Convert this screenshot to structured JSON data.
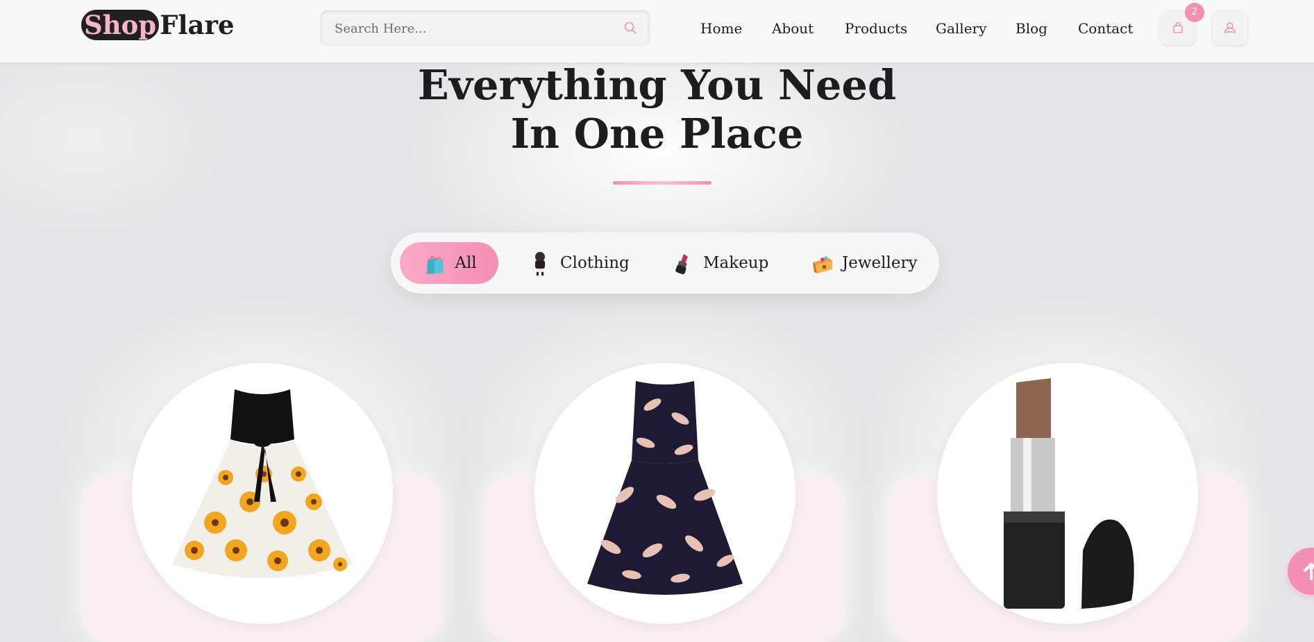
{
  "brand": {
    "part1": "Shop",
    "part2": "Flare"
  },
  "search": {
    "placeholder": "Search Here...",
    "value": "",
    "icon": "search-icon"
  },
  "nav": {
    "items": [
      {
        "label": "Home"
      },
      {
        "label": "About"
      },
      {
        "label": "Products"
      },
      {
        "label": "Gallery"
      },
      {
        "label": "Blog"
      },
      {
        "label": "Contact"
      }
    ]
  },
  "header_actions": {
    "cart_icon": "shopping-bag-icon",
    "cart_count": "2",
    "user_icon": "user-icon"
  },
  "hero": {
    "title_line1": "Everything You Need",
    "title_line2": "In One Place"
  },
  "filters": {
    "items": [
      {
        "label": "All",
        "icon": "shopping-bags-icon",
        "active": true
      },
      {
        "label": "Clothing",
        "icon": "clothing-icon",
        "active": false
      },
      {
        "label": "Makeup",
        "icon": "lipstick-icon",
        "active": false
      },
      {
        "label": "Jewellery",
        "icon": "treasure-chest-icon",
        "active": false
      }
    ]
  },
  "products": [
    {
      "image": "sunflower-dress-image"
    },
    {
      "image": "floral-dress-image"
    },
    {
      "image": "lipstick-image"
    }
  ],
  "colors": {
    "accent": "#f48fb4",
    "dark": "#202020",
    "card": "#f9eef2"
  },
  "scroll_top": {
    "icon": "arrow-up-icon"
  }
}
